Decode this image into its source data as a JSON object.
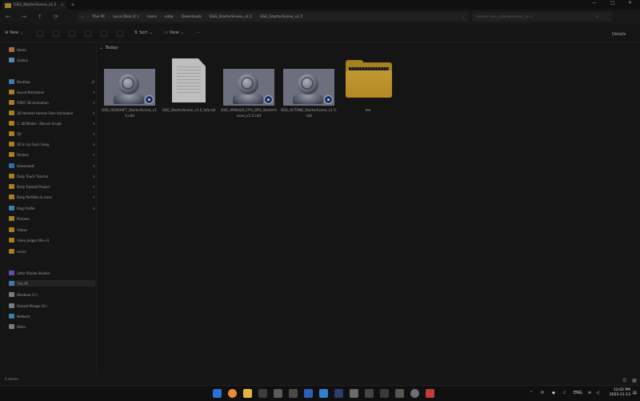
{
  "window": {
    "tab_title": "GSG_StarterScene_v1.5",
    "new_tab": "+",
    "controls": {
      "minimize": "—",
      "maximize": "□",
      "close": "✕"
    }
  },
  "address": {
    "crumbs": [
      "This PC",
      "Local Disk (C:)",
      "Users",
      "safar",
      "Downloads",
      "GSG_StarterScene_v1.5",
      "GSG_StarterScene_v1.5"
    ],
    "search_placeholder": "Search GSG_StarterScene_v1.5"
  },
  "toolbar": {
    "new_label": "New",
    "sort_label": "Sort",
    "view_label": "View",
    "more_label": "···",
    "details_label": "Details"
  },
  "sidebar": {
    "items": [
      {
        "label": "Home",
        "color": "#d98b54",
        "pinned": false
      },
      {
        "label": "Gallery",
        "color": "#6fb0d9",
        "pinned": false
      },
      {
        "label": "Desktop",
        "color": "#4aa3df",
        "pinned": true
      },
      {
        "label": "Sound Brimstone",
        "color": "#d6a324",
        "pinned": true
      },
      {
        "label": "FIRST 3D Animation",
        "color": "#d6a324",
        "pinned": true
      },
      {
        "label": "3D Hardest Human Face Animation",
        "color": "#d6a324",
        "pinned": true
      },
      {
        "label": "1. 3D Model - Zbrush Sculpt",
        "color": "#d6a324",
        "pinned": true
      },
      {
        "label": "3D",
        "color": "#d6a324",
        "pinned": true
      },
      {
        "label": "3D In Lip Sync Song",
        "color": "#d6a324",
        "pinned": true
      },
      {
        "label": "Strokes",
        "color": "#d6a324",
        "pinned": true
      },
      {
        "label": "Downloads",
        "color": "#3a8fdc",
        "pinned": true
      },
      {
        "label": "Daily Touch Tutorial",
        "color": "#d6a324",
        "pinned": true
      },
      {
        "label": "Daily Tutorial Project",
        "color": "#d6a324",
        "pinned": true
      },
      {
        "label": "Daily Portfolio & Icons",
        "color": "#d6a324",
        "pinned": true
      },
      {
        "label": "Blog Profile",
        "color": "#4aa3df",
        "pinned": true
      },
      {
        "label": "Pictures",
        "color": "#d6a324",
        "pinned": false
      },
      {
        "label": "Videos",
        "color": "#d6a324",
        "pinned": false
      },
      {
        "label": "Video Judges Mix v3",
        "color": "#d6a324",
        "pinned": false
      },
      {
        "label": "scene",
        "color": "#d6a324",
        "pinned": false
      }
    ],
    "drives": [
      {
        "label": "Safar Rhaida Studios",
        "color": "#7a66d9"
      },
      {
        "label": "This PC",
        "color": "#4aa3df"
      },
      {
        "label": "Windows (C:)",
        "color": "#9aa0a8"
      },
      {
        "label": "Shared Mirage (D:)",
        "color": "#9aa0a8"
      },
      {
        "label": "Network",
        "color": "#4aa3df"
      },
      {
        "label": "Other",
        "color": "#9aa0a8"
      }
    ]
  },
  "content": {
    "group_label": "Today",
    "files": [
      {
        "name": "GSG_REDSHIFT_StarterScene_v1.5.c4d",
        "kind": "c4d"
      },
      {
        "name": "GSG_StarterScene_v1.5_Info.txt",
        "kind": "txt"
      },
      {
        "name": "GSG_ARNOLD_CPU_GPU_StarterScene_v1.5.c4d",
        "kind": "c4d"
      },
      {
        "name": "GSG_OCTANE_StarterScene_v1.5.c4d",
        "kind": "c4d"
      },
      {
        "name": "tex",
        "kind": "folder"
      }
    ]
  },
  "status": {
    "items_text": "5 items"
  },
  "taskbar": {
    "lang": "ENG",
    "time": "12:02 PM",
    "date": "2023-11-13"
  }
}
